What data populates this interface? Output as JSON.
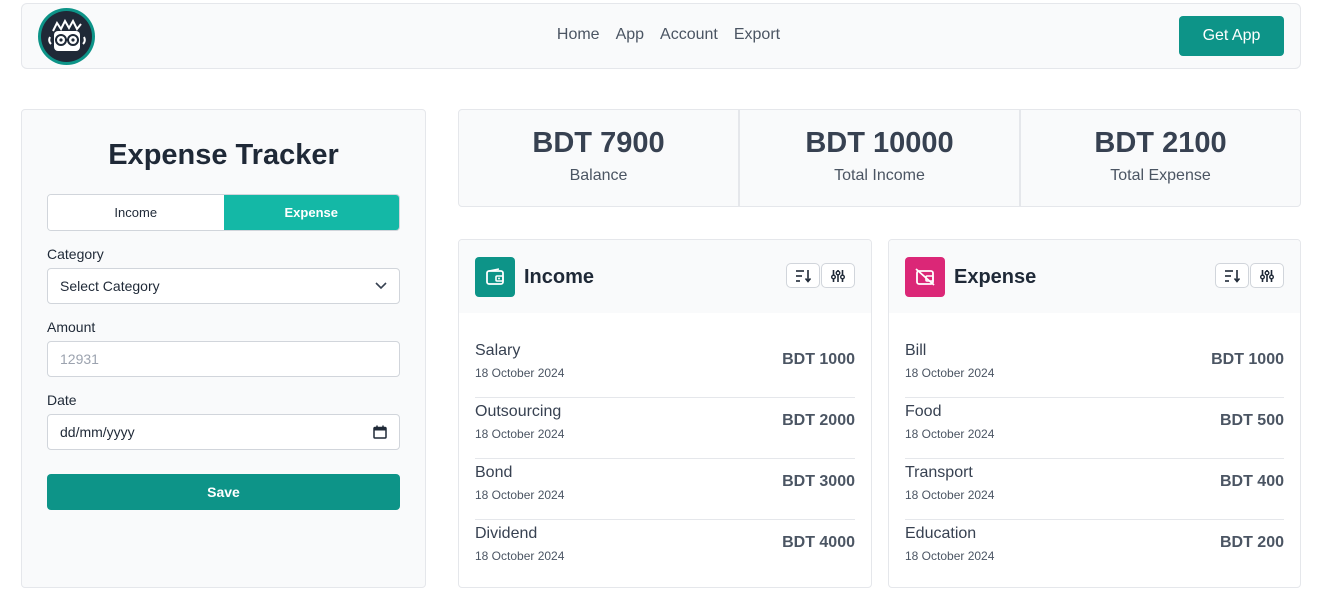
{
  "nav": {
    "links": [
      "Home",
      "App",
      "Account",
      "Export"
    ],
    "cta_label": "Get App"
  },
  "form": {
    "title": "Expense Tracker",
    "toggle": {
      "income_label": "Income",
      "expense_label": "Expense",
      "active": "Expense"
    },
    "category_label": "Category",
    "category_value": "Select Category",
    "amount_label": "Amount",
    "amount_placeholder": "12931",
    "date_label": "Date",
    "date_placeholder": "dd/mm/yyyy",
    "save_label": "Save"
  },
  "stats": [
    {
      "value": "BDT 7900",
      "label": "Balance"
    },
    {
      "value": "BDT 10000",
      "label": "Total Income"
    },
    {
      "value": "BDT 2100",
      "label": "Total Expense"
    }
  ],
  "income": {
    "title": "Income",
    "items": [
      {
        "name": "Salary",
        "date": "18 October 2024",
        "amount": "BDT 1000"
      },
      {
        "name": "Outsourcing",
        "date": "18 October 2024",
        "amount": "BDT 2000"
      },
      {
        "name": "Bond",
        "date": "18 October 2024",
        "amount": "BDT 3000"
      },
      {
        "name": "Dividend",
        "date": "18 October 2024",
        "amount": "BDT 4000"
      }
    ]
  },
  "expense": {
    "title": "Expense",
    "items": [
      {
        "name": "Bill",
        "date": "18 October 2024",
        "amount": "BDT 1000"
      },
      {
        "name": "Food",
        "date": "18 October 2024",
        "amount": "BDT 500"
      },
      {
        "name": "Transport",
        "date": "18 October 2024",
        "amount": "BDT 400"
      },
      {
        "name": "Education",
        "date": "18 October 2024",
        "amount": "BDT 200"
      }
    ]
  },
  "colors": {
    "primary": "#0d9488",
    "toggle_active": "#14b8a6",
    "expense_accent": "#db2777"
  },
  "icons": {
    "logo": "nerd-avatar-logo",
    "income": "wallet-icon",
    "expense": "wallet-off-icon",
    "sort": "sort-icon",
    "filter": "sliders-icon",
    "select": "chevron-down-icon",
    "date": "calendar-icon"
  }
}
